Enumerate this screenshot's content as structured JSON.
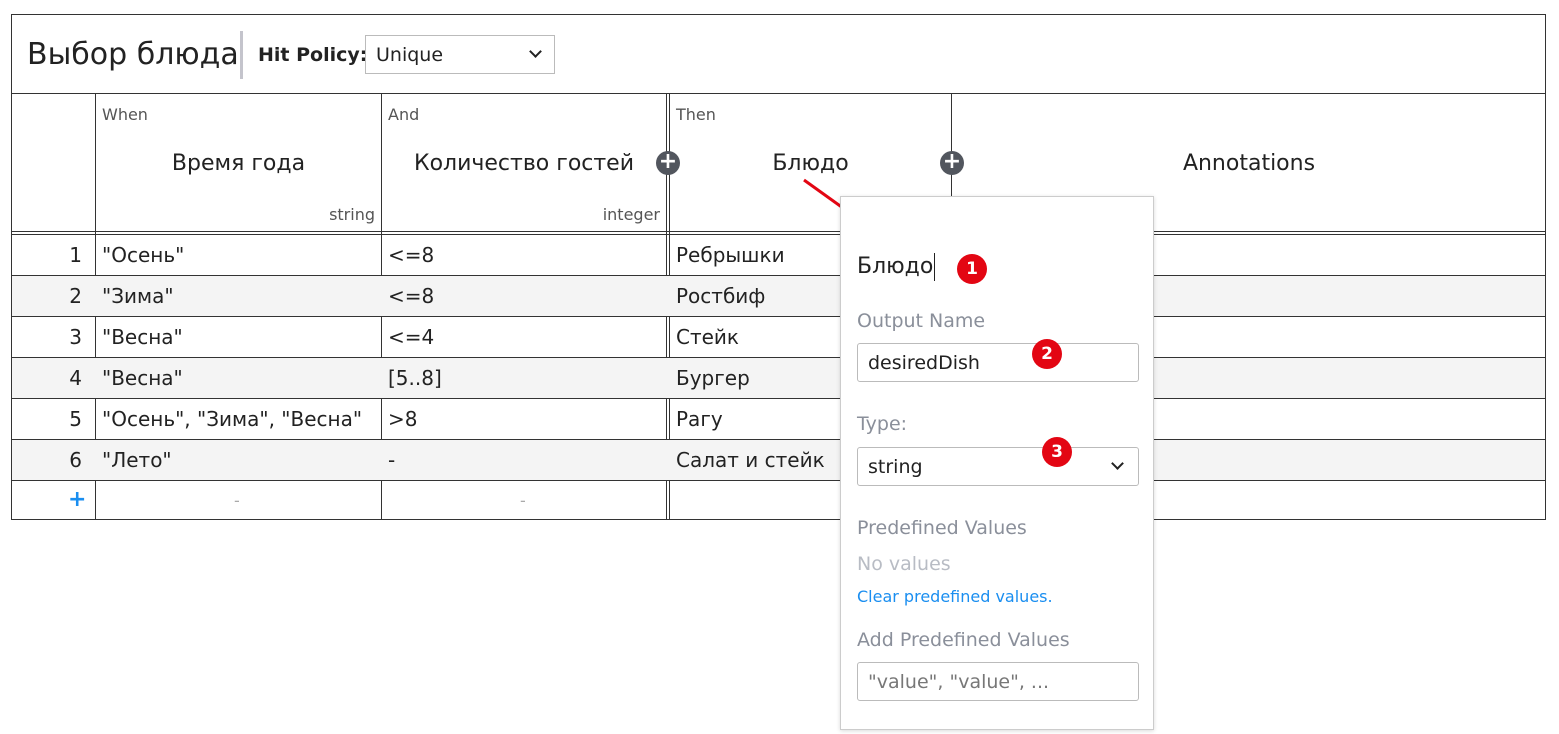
{
  "table": {
    "title": "Выбор блюда",
    "hit_policy_label": "Hit Policy:",
    "hit_policy_value": "Unique",
    "columns": [
      {
        "kind": "When",
        "name": "Время года",
        "type": "string"
      },
      {
        "kind": "And",
        "name": "Количество гостей",
        "type": "integer"
      },
      {
        "kind": "Then",
        "name": "Блюдо",
        "type": ""
      },
      {
        "kind": "",
        "name": "Annotations",
        "type": ""
      }
    ],
    "rows": [
      {
        "num": "1",
        "season": "\"Осень\"",
        "guests": "<=8",
        "dish": "Ребрышки"
      },
      {
        "num": "2",
        "season": "\"Зима\"",
        "guests": "<=8",
        "dish": "Ростбиф"
      },
      {
        "num": "3",
        "season": "\"Весна\"",
        "guests": "<=4",
        "dish": "Стейк"
      },
      {
        "num": "4",
        "season": "\"Весна\"",
        "guests": "[5..8]",
        "dish": "Бургер"
      },
      {
        "num": "5",
        "season": "\"Осень\", \"Зима\", \"Весна\"",
        "guests": ">8",
        "dish": "Рагу"
      },
      {
        "num": "6",
        "season": "\"Лето\"",
        "guests": "-",
        "dish": "Салат и стейк"
      }
    ],
    "add_row_symbol": "+",
    "add_row_placeholders": [
      "-",
      "-"
    ],
    "add_column_symbol": "+"
  },
  "popup": {
    "label_value": "Блюдо",
    "output_name_label": "Output Name",
    "output_name_value": "desiredDish",
    "type_label": "Type:",
    "type_value": "string",
    "predefined_label": "Predefined Values",
    "no_values_text": "No values",
    "clear_link": "Clear predefined values.",
    "add_predefined_label": "Add Predefined Values",
    "add_predefined_placeholder": "\"value\", \"value\", ..."
  },
  "badges": [
    "1",
    "2",
    "3"
  ],
  "colors": {
    "badge": "#e30613",
    "link": "#1a8ef0",
    "add_column_button": "#52565e",
    "row_alt": "#f4f4f4"
  }
}
